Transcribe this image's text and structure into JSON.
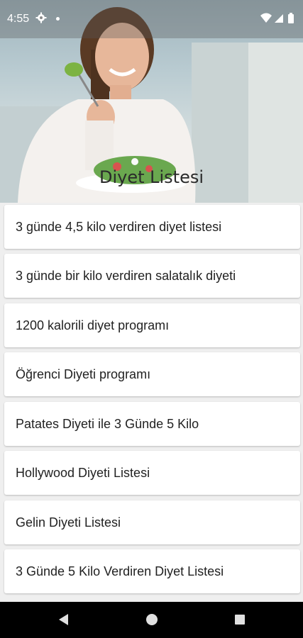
{
  "status": {
    "time": "4:55"
  },
  "header": {
    "title": "Diyet Listesi"
  },
  "diets": [
    {
      "label": "3 günde 4,5 kilo verdiren diyet listesi"
    },
    {
      "label": "3 günde bir kilo verdiren salatalık diyeti"
    },
    {
      "label": "1200 kalorili diyet programı"
    },
    {
      "label": "Öğrenci Diyeti programı"
    },
    {
      "label": "Patates Diyeti ile 3 Günde 5 Kilo"
    },
    {
      "label": "Hollywood Diyeti Listesi"
    },
    {
      "label": "Gelin Diyeti Listesi"
    },
    {
      "label": "3 Günde 5 Kilo Verdiren Diyet Listesi"
    }
  ],
  "colors": {
    "background": "#efefef",
    "card": "#ffffff",
    "navbar": "#000000"
  }
}
